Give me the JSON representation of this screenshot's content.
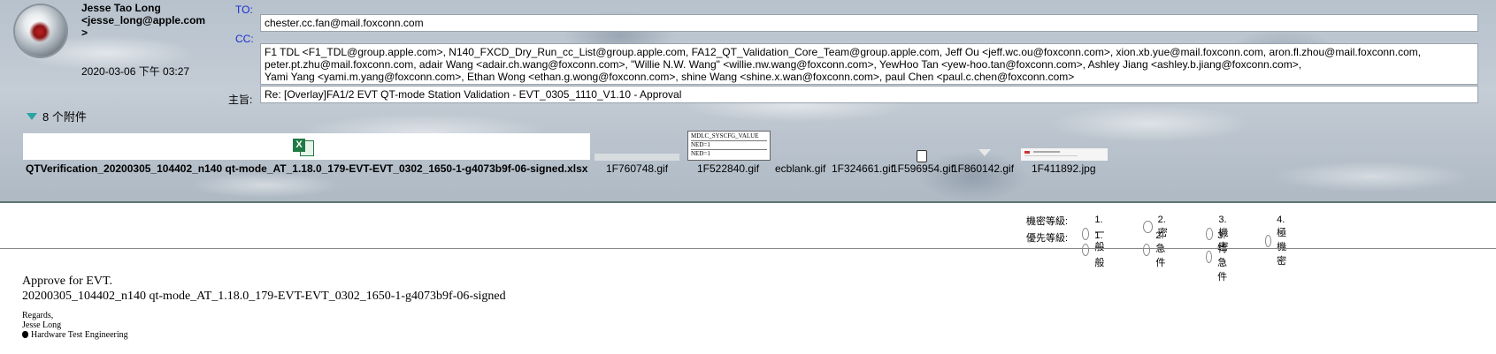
{
  "sender": {
    "name": "Jesse Tao Long\n<jesse_long@apple.com\n>",
    "date": "2020-03-06 下午 03:27"
  },
  "fields": {
    "to_label": "TO:",
    "to_value": "chester.cc.fan@mail.foxconn.com",
    "cc_label": "CC:",
    "cc_lines": [
      "F1 TDL <F1_TDL@group.apple.com>, N140_FXCD_Dry_Run_cc_List@group.apple.com, FA12_QT_Validation_Core_Team@group.apple.com, Jeff Ou <jeff.wc.ou@foxconn.com>, xion.xb.yue@mail.foxconn.com, aron.fl.zhou@mail.foxconn.com,",
      "peter.pt.zhu@mail.foxconn.com, adair Wang <adair.ch.wang@foxconn.com>, \"Willie N.W. Wang\" <willie.nw.wang@foxconn.com>, YewHoo Tan <yew-hoo.tan@foxconn.com>, Ashley Jiang <ashley.b.jiang@foxconn.com>,",
      "Yami Yang <yami.m.yang@foxconn.com>, Ethan Wong <ethan.g.wong@foxconn.com>, shine Wang <shine.x.wan@foxconn.com>, paul Chen <paul.c.chen@foxconn.com>"
    ],
    "subject_label": "主旨:",
    "subject_value": "Re: [Overlay]FA1/2 EVT QT-mode Station Validation - EVT_0305_1110_V1.10 - Approval"
  },
  "attachments": {
    "toggle_label": "8 个附件",
    "files": [
      "QTVerification_20200305_104402_n140 qt-mode_AT_1.18.0_179-EVT-EVT_0302_1650-1-g4073b9f-06-signed.xlsx",
      "1F760748.gif",
      "1F522840.gif",
      "ecblank.gif",
      "1F324661.gif",
      "1F596954.gif",
      "1F860142.gif",
      "1F411892.jpg"
    ],
    "thumb_text": [
      "MDLC_SYSCFG_VALUE",
      "NED=1",
      "NED=1"
    ],
    "excel_icon_letter": "X"
  },
  "priority": {
    "secrecy_label": "機密等級:",
    "secrecy_options": [
      "1.一般",
      "2.密",
      "3.機密",
      "4.極機密"
    ],
    "urgency_label": "優先等級:",
    "urgency_options": [
      "1.一般",
      "2.急件",
      "3.特急件"
    ]
  },
  "body": {
    "line1": "Approve for EVT.",
    "line2": "20200305_104402_n140 qt-mode_AT_1.18.0_179-EVT-EVT_0302_1650-1-g4073b9f-06-signed",
    "regards": "Regards,",
    "name": "Jesse Long",
    "team": "Hardware Test Engineering",
    "apple_glyph": ""
  }
}
